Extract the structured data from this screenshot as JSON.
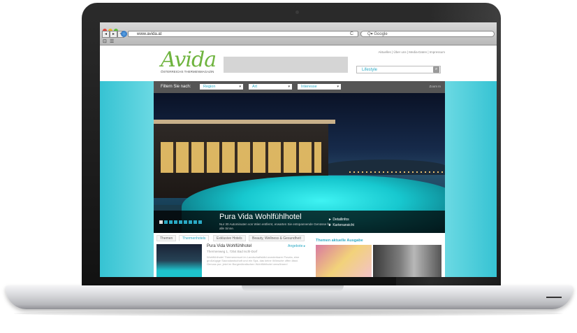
{
  "browser": {
    "url": "www.avida.at",
    "search_placeholder": "Google",
    "nav_back": "◂",
    "nav_forward": "▸",
    "nav_add": "+",
    "reload_icon": "C",
    "search_icon": "Q▾",
    "bookmarks": [
      "⊡",
      "☰"
    ]
  },
  "site": {
    "logo": "Avida",
    "tagline": "ÖSTERREICHS THERMENMAGAZIN",
    "top_links": "Aktuelles | Über uns | Media-Daten | Impressum",
    "search_value": "Lifestyle",
    "search_button_icon": "⌕"
  },
  "filter": {
    "label": "Filtern Sie nach:",
    "dropdowns": [
      "Region",
      "Art",
      "Interesse"
    ],
    "zoom_label": "Zoom In"
  },
  "hero": {
    "title": "Pura Vida Wohlfühlhotel",
    "subtitle": "Nur 30 Autominuten von Wien entfernt, erwarten Sie entspannende Genüsse für alle Sinne.",
    "links": [
      "► Detailinfos",
      "► Kartenansicht"
    ],
    "slides_total": 9,
    "slide_active": 1
  },
  "tabs": [
    "Themen",
    "Thermenhotels",
    "Exklusive Hotels",
    "Beauty, Wellness & Gesundheit"
  ],
  "active_tab": "Thermenhotels",
  "listing": {
    "title": "Pura Vida Wohlfühlhotel",
    "badge": "Angebote ▸",
    "subtitle": "Thermenweg 1, 7254 Bad Ischl-Dorf",
    "text": "Wohlfühlhotel Thermenresort im Landschaftsbild wunderbarer Puszta, eine großzügige Saunalandschaft und ein Spa, das keine Wünsche offen lässt. Genuss pur, jetzt im Burgenländischen Wohlfühlhotel verwöhnen!"
  },
  "right_panel": {
    "title": "Themen aktuelle Ausgabe"
  },
  "colors": {
    "accent": "#2aa9c4",
    "logo_green": "#6fb43f",
    "teal": "#36c3d3"
  }
}
